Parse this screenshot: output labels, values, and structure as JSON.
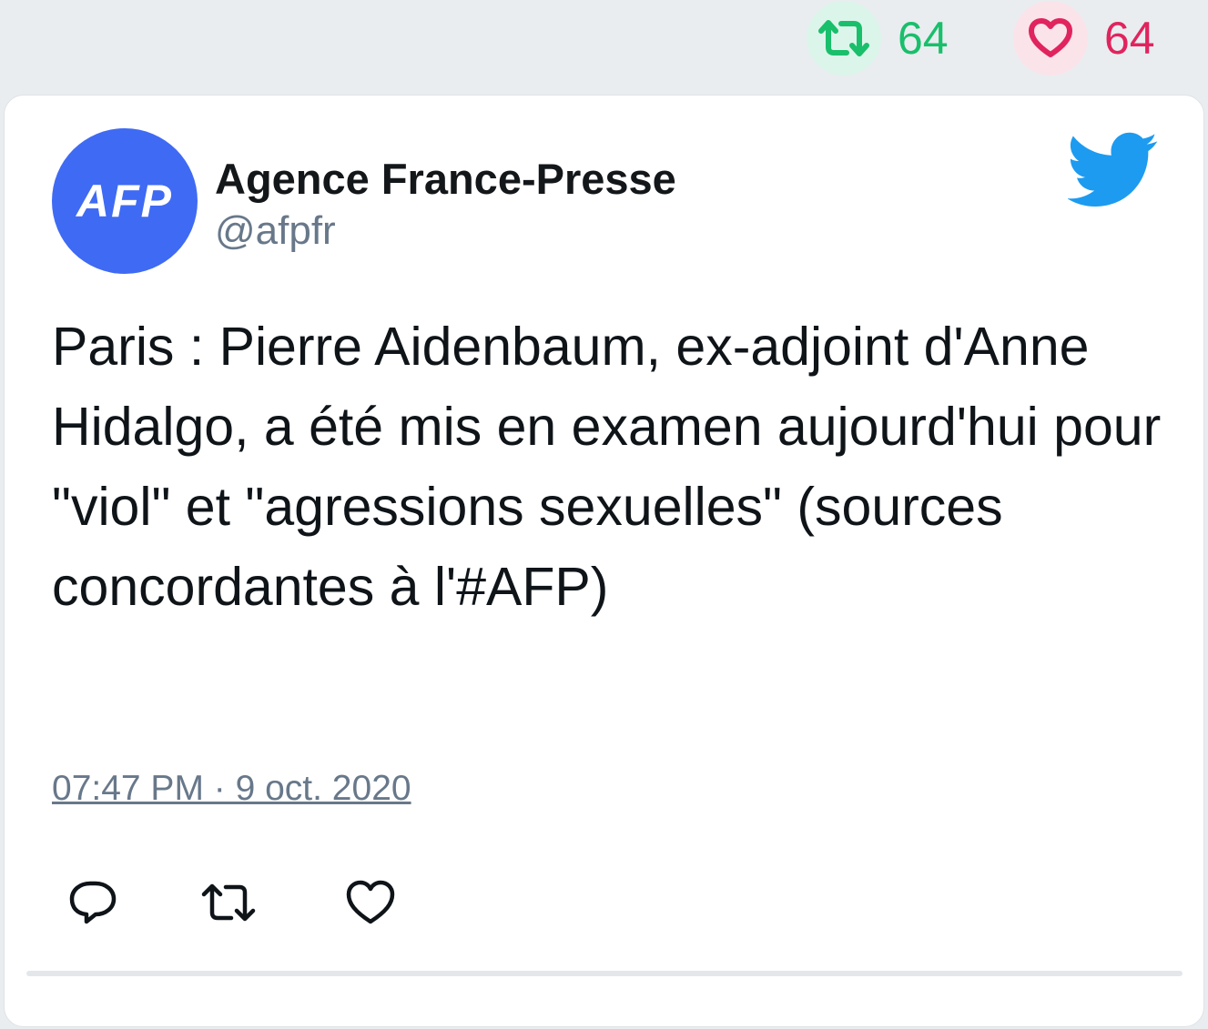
{
  "top_stats": {
    "retweets": "64",
    "likes": "64"
  },
  "tweet": {
    "author_name": "Agence France-Presse",
    "author_handle": "@afpfr",
    "avatar_text": "AFP",
    "text": "Paris : Pierre Aidenbaum, ex-adjoint d'Anne Hidalgo, a été mis en examen aujourd'hui pour \"viol\" et \"agressions sexuelles\" (sources concordantes à l'#AFP)",
    "timestamp": "07:47 PM · 9 oct. 2020"
  },
  "icons": {
    "retweet": "retweet-icon",
    "like": "heart-icon",
    "reply": "reply-icon",
    "brand": "twitter-bird-icon"
  },
  "colors": {
    "retweet_green": "#19bf6b",
    "like_red": "#e0245e",
    "twitter_blue": "#1d9bf0",
    "avatar_blue": "#3f6af3"
  }
}
